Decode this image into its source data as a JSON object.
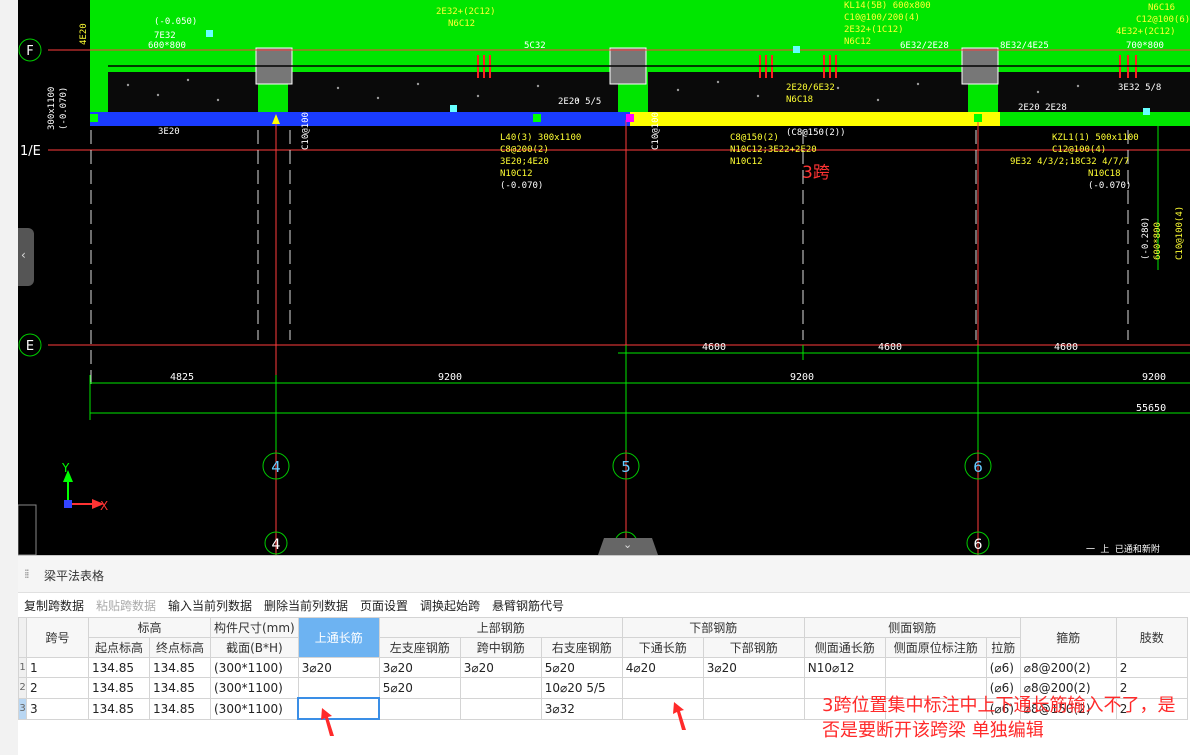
{
  "cad": {
    "axis_rows": {
      "F": "F",
      "one_E": "1/E",
      "E": "E"
    },
    "axis_cols": [
      "4",
      "5",
      "6"
    ],
    "axis_cols_bottom": [
      "4",
      "5",
      "6"
    ],
    "dims_top": [
      "4600",
      "4600",
      "4600"
    ],
    "dims_row": [
      "4825",
      "9200",
      "9200",
      "9200"
    ],
    "dims_total": "55650",
    "span_mark": "3跨",
    "ucs": {
      "x": "X",
      "y": "Y"
    },
    "labels": {
      "l1": "(-0.050)",
      "l2": "600*800",
      "l3": "7E32",
      "l4": "4E20",
      "l5": "5C32",
      "l6": "6E32/2E28",
      "l7": "8E32/4E25",
      "l8": "700*800",
      "l9": "4E32+(2C12)",
      "l10": "C12@100(6)",
      "l11": "N6C16",
      "l12": "2E32+(2C12)",
      "l13": "N6C12",
      "l14": "2E20 2E28",
      "l15": "KL14(5B) 600x800",
      "l16": "C10@100/200(4)",
      "l17": "2E32+(1C12)",
      "l18": "N6C12",
      "l19": "2E20/6E32",
      "l20": "N6C18",
      "l21": "3E32 5/8",
      "l22": "L40(3) 300x1100",
      "l23": "C8@200(2)",
      "l24": "3E20;4E20",
      "l25": "N10C12",
      "l26": "(-0.070)",
      "l27": "C8@150(2)",
      "l28": "N10C12;3E22+2E20",
      "l29": "N10C12",
      "l30": "KZL1(1) 500x1100",
      "l31": "C12@100(4)",
      "l32": "9E32 4/3/2;18C32 4/7/7",
      "l33": "N10C18",
      "l34": "(-0.070)",
      "l35": "300x1100",
      "l36": "(-0.070)",
      "l37": "3E20",
      "l38": "(C8@150(2))",
      "l39": "2E20 5/5",
      "l40": "C10@100",
      "l41": "600*800",
      "l42": "C10@100(4)",
      "l43": "(-0.280)",
      "l44": "一 上  已通和新附"
    }
  },
  "panel": {
    "title": "梁平法表格",
    "toolbar": [
      "复制跨数据",
      "粘贴跨数据",
      "输入当前列数据",
      "删除当前列数据",
      "页面设置",
      "调换起始跨",
      "悬臂钢筋代号"
    ],
    "headers_top": {
      "span_no": "跨号",
      "elevation": "标高",
      "size": "构件尺寸(mm)",
      "top_through": "上通长筋",
      "top_rebar": "上部钢筋",
      "bottom_rebar": "下部钢筋",
      "side_rebar": "侧面钢筋",
      "stirrup": "箍筋",
      "legs": "肢数"
    },
    "headers_sub": [
      "起点标高",
      "终点标高",
      "截面(B*H)",
      "左支座钢筋",
      "跨中钢筋",
      "右支座钢筋",
      "下通长筋",
      "下部钢筋",
      "侧面通长筋",
      "侧面原位标注筋",
      "拉筋"
    ],
    "rows": [
      {
        "rn": "1",
        "span": "1",
        "start": "134.85",
        "end": "134.85",
        "section": "(300*1100)",
        "top_thru": "3⌀20",
        "left": "3⌀20",
        "mid": "3⌀20",
        "right": "5⌀20",
        "bot_thru": "4⌀20",
        "bot": "3⌀20",
        "side_thru": "N10⌀12",
        "side_orig": "",
        "tie": "(⌀6)",
        "stirrup": "⌀8@200(2)",
        "legs": "2"
      },
      {
        "rn": "2",
        "span": "2",
        "start": "134.85",
        "end": "134.85",
        "section": "(300*1100)",
        "top_thru": "",
        "left": "5⌀20",
        "mid": "",
        "right": "10⌀20 5/5",
        "bot_thru": "",
        "bot": "",
        "side_thru": "",
        "side_orig": "",
        "tie": "(⌀6)",
        "stirrup": "⌀8@200(2)",
        "legs": "2"
      },
      {
        "rn": "3",
        "span": "3",
        "start": "134.85",
        "end": "134.85",
        "section": "(300*1100)",
        "top_thru": "",
        "left": "",
        "mid": "",
        "right": "3⌀32",
        "bot_thru": "",
        "bot": "",
        "side_thru": "",
        "side_orig": "",
        "tie": "(⌀6)",
        "stirrup": "⌀8@150(2)",
        "legs": "2"
      }
    ]
  },
  "annotation": "3跨位置集中标注中上下通长筋输入不了，是否是要断开该跨梁 单独编辑",
  "colors": {
    "beam_fill": "#00e600",
    "axis_line": "#ff3b3b",
    "dim_line": "#00e600",
    "axis_bubble": "#00cc00",
    "header_selected": "#6db3f2",
    "annotation": "#ff2a2a"
  }
}
